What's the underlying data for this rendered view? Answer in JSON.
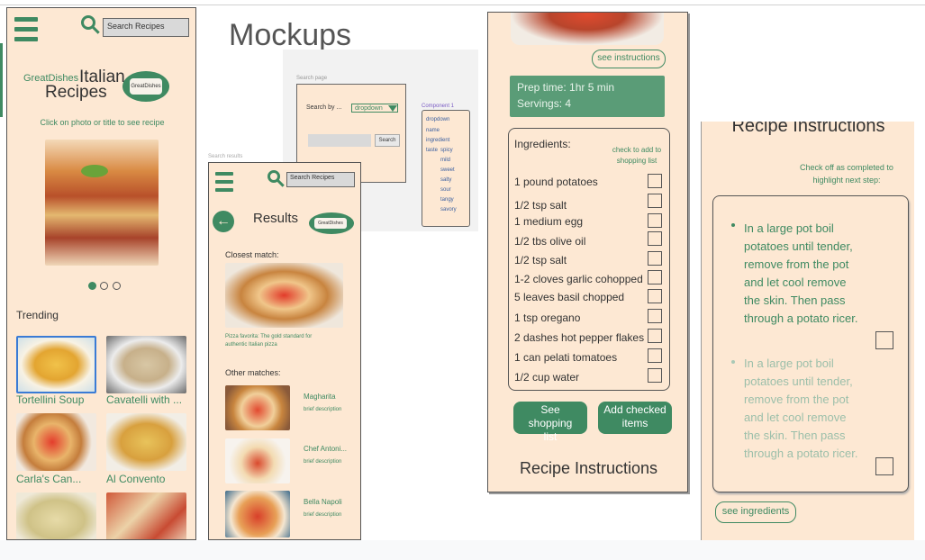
{
  "page_title": "Mockups",
  "home": {
    "search_placeholder": "Search Recipes",
    "brand_small": "GreatDishes",
    "brand_big1": "Italian",
    "brand_big2": "Recipes",
    "logo_text": "GreatDishes",
    "hint": "Click on photo or title to see recipe",
    "trending_label": "Trending",
    "trending": [
      {
        "label": "Tortellini Soup"
      },
      {
        "label": "Cavatelli with ..."
      },
      {
        "label": "Carla's Can..."
      },
      {
        "label": "Al Convento"
      }
    ]
  },
  "wireframe": {
    "label": "Search page",
    "search_by": "Search by ...",
    "dropdown": "dropdown",
    "search_btn": "Search",
    "component": "Component 1",
    "options": [
      "dropdown",
      "name",
      "ingredient",
      "taste",
      "spicy",
      "mild",
      "sweet",
      "salty",
      "sour",
      "tangy",
      "savory"
    ]
  },
  "results": {
    "frame_label": "Search results",
    "search_placeholder": "Search Recipes",
    "title": "Results",
    "logo_text": "GreatDishes",
    "closest_label": "Closest match:",
    "closest_caption": "Pizza favorita: The gold standard for authentic Italian pizza",
    "other_label": "Other matches:",
    "matches": [
      {
        "name": "Magharita",
        "desc": "brief description"
      },
      {
        "name": "Chef Antoni...",
        "desc": "brief description"
      },
      {
        "name": "Bella Napoli",
        "desc": "brief description"
      }
    ]
  },
  "recipe": {
    "see_instructions": "see instructions",
    "prep_time": "Prep time: 1hr 5 min",
    "servings": "Servings: 4",
    "ingredients_label": "Ingredients:",
    "check_hint": "check to add to shopping list",
    "ingredients": [
      "1 pound potatoes",
      "1/2 tsp salt",
      "1 medium egg",
      "1/2 tbs olive oil",
      "1/2 tsp salt",
      "1-2 cloves garlic cohopped",
      "5 leaves basil chopped",
      "1 tsp oregano",
      "2 dashes hot pepper flakes",
      "1 can pelati tomatoes",
      "1/2 cup water"
    ],
    "see_shopping": "See shopping list",
    "add_checked": "Add checked items",
    "instructions_heading": "Recipe Instructions"
  },
  "instructions": {
    "title": "Recipe Instructions",
    "hint": "Check off as completed to highlight next step:",
    "step1": "In a large pot boil potatoes until tender, remove from the pot and let cool remove the skin. Then pass through a potato ricer.",
    "step2": "In a large pot boil potatoes until tender, remove from the pot and let cool remove the skin. Then pass through a potato ricer.",
    "see_ingredients": "see ingredients"
  },
  "colors": {
    "accent": "#3f8a62",
    "panel": "#fde8d3"
  }
}
